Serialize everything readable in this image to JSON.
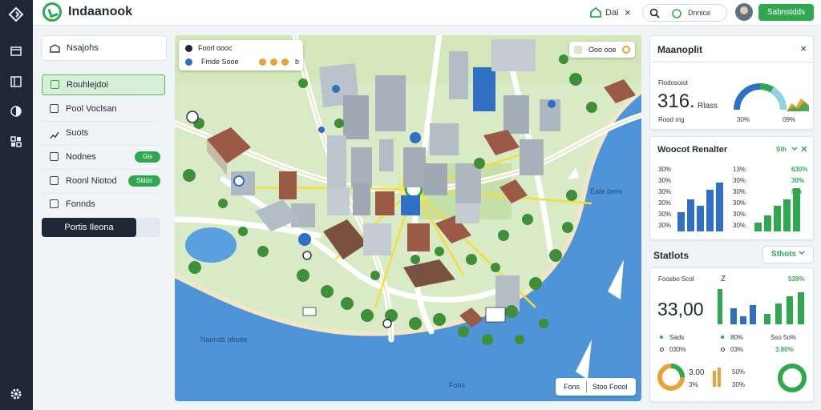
{
  "app": {
    "title": "Indaanook"
  },
  "topbar": {
    "home_label": "Dai",
    "close_glyph": "×",
    "search_label": "Dnnice",
    "action_label": "Sabnstdds"
  },
  "rail": {
    "icons": [
      "diamond-icon",
      "folder-icon",
      "layout-icon",
      "contrast-icon",
      "grid-icon"
    ],
    "bottom_icon": "gear-icon"
  },
  "sidebar": {
    "header_label": "Nsajohs",
    "items": [
      {
        "label": "Rouhlejdoi",
        "active": true
      },
      {
        "label": "Pool Voclsan"
      },
      {
        "label": "Suots"
      },
      {
        "label": "Nodnes",
        "badge": "Gls"
      },
      {
        "label": "Roonl Niotod",
        "badge": "Sldds"
      },
      {
        "label": "Fonnds"
      }
    ],
    "button_label": "Portis Ileona"
  },
  "map": {
    "card1": {
      "line1": "Foorl oooc",
      "line2": "Fmde  Sooe",
      "status_dots": [
        "#e8a23a",
        "#e8a23a",
        "#e8a23a"
      ],
      "end": "b"
    },
    "card2": {
      "label": "Ooo  ooe"
    },
    "water_label_left": "Naonsb ofoote",
    "water_label_right": "Eafe beris",
    "water_label_bottom": "Foos",
    "bottom_bar": {
      "left": "Fons",
      "right": "Stoo Foool"
    }
  },
  "panel_top": {
    "title": "Maanoplit",
    "close_glyph": "×",
    "label": "Flodosoiot",
    "value": "316.",
    "unit": "Rlass",
    "sub": "Rood mg",
    "p1": "30%",
    "p2": "09%"
  },
  "panel_mid": {
    "title": "Woocot Renalter",
    "pill": "Sth",
    "rows_left": [
      "30%",
      "30%",
      "30%",
      "30%",
      "30%",
      "30%"
    ],
    "rows_mid": [
      "13%",
      "30%",
      "30%",
      "30%",
      "30%",
      "30%"
    ],
    "rows_right": [
      "630%",
      "30%",
      "Sth"
    ],
    "bars_blue": [
      0.33,
      0.55,
      0.45,
      0.72,
      0.85
    ],
    "bars_green": [
      0.15,
      0.28,
      0.45,
      0.55,
      0.75
    ]
  },
  "stats": {
    "title": "Statlots",
    "pill": "Sthots",
    "label": "Foosbo Scol",
    "corner": "Z",
    "pct_top": "539%",
    "value": "33,00",
    "rows": [
      {
        "a": "Sads",
        "b": "80%",
        "c": "Sso 5o%"
      },
      {
        "a": "030%",
        "b": "03%",
        "c": "3.80%"
      }
    ],
    "bottom_a": "3.00",
    "bottom_b": "3%",
    "bottom_c": "50%",
    "bottom_d": "30%",
    "bars_green": [
      0.3,
      0.5,
      0.8,
      1.0
    ],
    "bars_blue": [
      0.6,
      0.3,
      0.7
    ],
    "bars_green2": [
      0.3,
      0.6,
      0.8,
      0.9
    ]
  },
  "colors": {
    "accent": "#2fa84f",
    "dark": "#1d2735",
    "blue": "#2f6fc4",
    "water": "#4f94d7"
  }
}
